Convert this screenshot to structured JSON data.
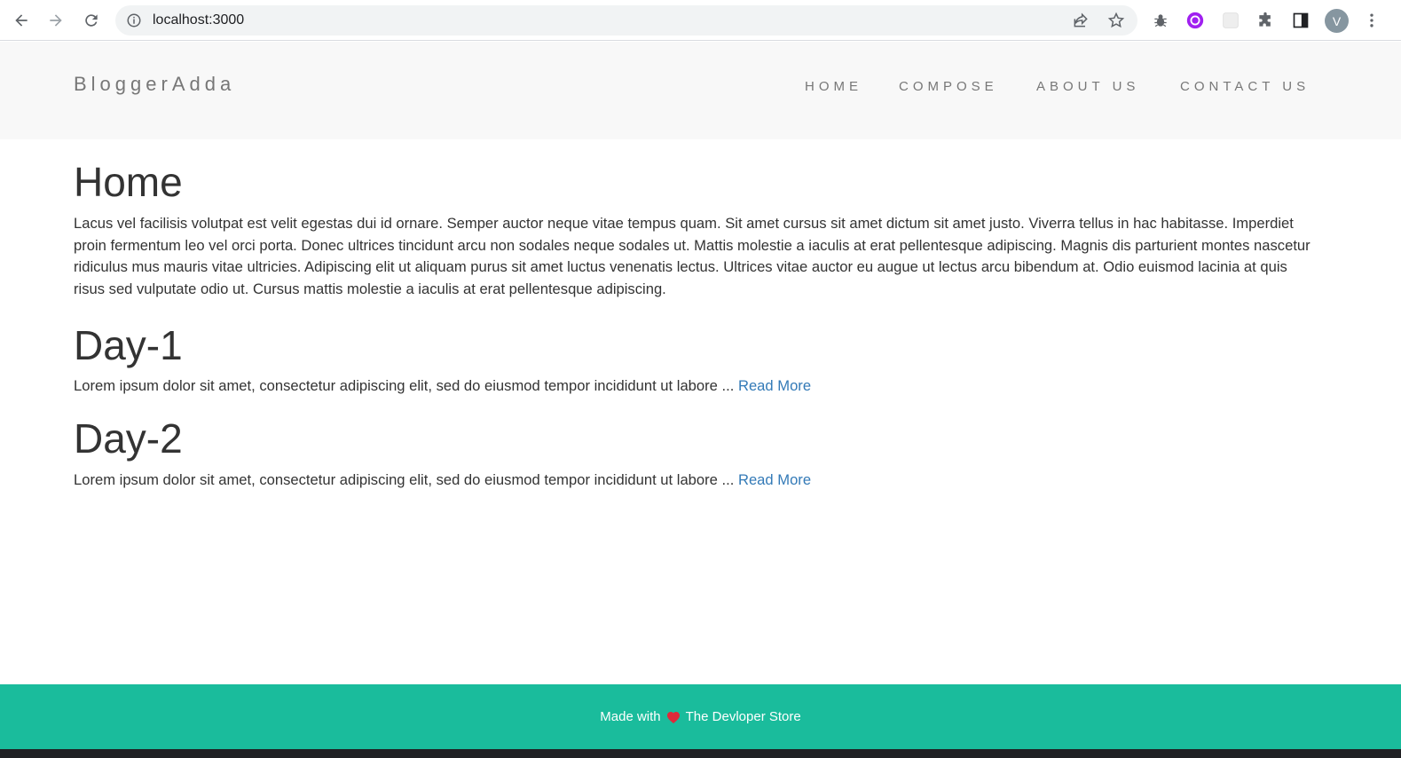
{
  "browser": {
    "url": "localhost:3000",
    "avatar_letter": "V"
  },
  "site": {
    "brand": "BloggerAdda",
    "nav": [
      "HOME",
      "COMPOSE",
      "ABOUT US",
      "CONTACT US"
    ]
  },
  "home": {
    "title": "Home",
    "text": "Lacus vel facilisis volutpat est velit egestas dui id ornare. Semper auctor neque vitae tempus quam. Sit amet cursus sit amet dictum sit amet justo. Viverra tellus in hac habitasse. Imperdiet proin fermentum leo vel orci porta. Donec ultrices tincidunt arcu non sodales neque sodales ut. Mattis molestie a iaculis at erat pellentesque adipiscing. Magnis dis parturient montes nascetur ridiculus mus mauris vitae ultricies. Adipiscing elit ut aliquam purus sit amet luctus venenatis lectus. Ultrices vitae auctor eu augue ut lectus arcu bibendum at. Odio euismod lacinia at quis risus sed vulputate odio ut. Cursus mattis molestie a iaculis at erat pellentesque adipiscing."
  },
  "posts": [
    {
      "title": "Day-1",
      "excerpt": "Lorem ipsum dolor sit amet, consectetur adipiscing elit, sed do eiusmod tempor incididunt ut labore ...",
      "read_more": "Read More"
    },
    {
      "title": "Day-2",
      "excerpt": "Lorem ipsum dolor sit amet, consectetur adipiscing elit, sed do eiusmod tempor incididunt ut labore ...",
      "read_more": "Read More"
    }
  ],
  "footer": {
    "made_with": "Made with",
    "store": "The Devloper Store"
  },
  "colors": {
    "footer_bg": "#1abc9c",
    "link": "#337ab7",
    "header_bg": "#f8f8f8",
    "heart": "#e0293a"
  },
  "icons": [
    "back-arrow-icon",
    "forward-arrow-icon",
    "reload-icon",
    "info-icon",
    "share-icon",
    "star-icon",
    "bug-icon",
    "extension-purple-icon",
    "extension-blank-icon",
    "puzzle-icon",
    "sidebar-icon",
    "kebab-menu-icon",
    "heart-icon"
  ]
}
